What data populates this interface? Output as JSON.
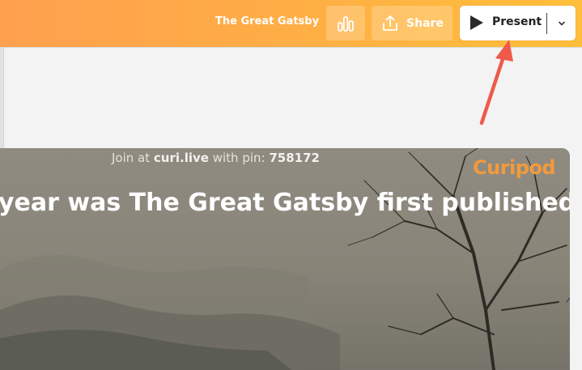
{
  "header": {
    "title": "The Great Gatsby",
    "stats_icon": "bar-chart-icon",
    "share_icon": "share-upload-icon",
    "share_label": "Share",
    "present_label": "Present",
    "present_icon": "play-icon",
    "dropdown_icon": "chevron-down-icon"
  },
  "slide": {
    "join_prefix": "Join at",
    "join_site": "curi.live",
    "join_middle": "with pin:",
    "join_pin": "758172",
    "brand": "Curipod",
    "question": "year was The Great Gatsby first published?"
  },
  "annotation": {
    "arrow_color": "#ef5a4a"
  }
}
